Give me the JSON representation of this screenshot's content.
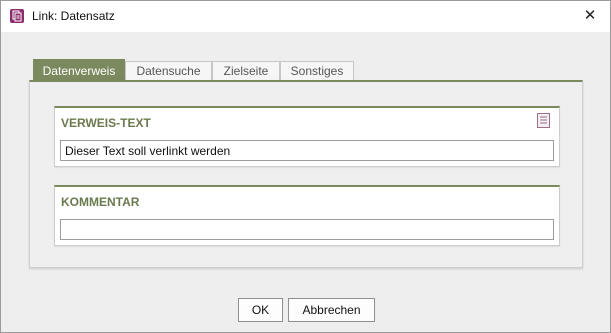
{
  "window": {
    "title": "Link: Datensatz",
    "close_symbol": "✕",
    "app_icon": "document-link-icon"
  },
  "tabs": [
    {
      "label": "Datenverweis",
      "active": true
    },
    {
      "label": "Datensuche",
      "active": false
    },
    {
      "label": "Zielseite",
      "active": false
    },
    {
      "label": "Sonstiges",
      "active": false
    }
  ],
  "sections": {
    "verweis": {
      "title": "VERWEIS-TEXT",
      "value": "Dieser Text soll verlinkt werden",
      "icon": "document-icon"
    },
    "kommentar": {
      "title": "KOMMENTAR",
      "value": ""
    }
  },
  "buttons": {
    "ok": "OK",
    "cancel": "Abbrechen"
  },
  "colors": {
    "accent": "#7a8a5e",
    "app_icon": "#8c2d6e",
    "section_title": "#6a7a4e"
  }
}
